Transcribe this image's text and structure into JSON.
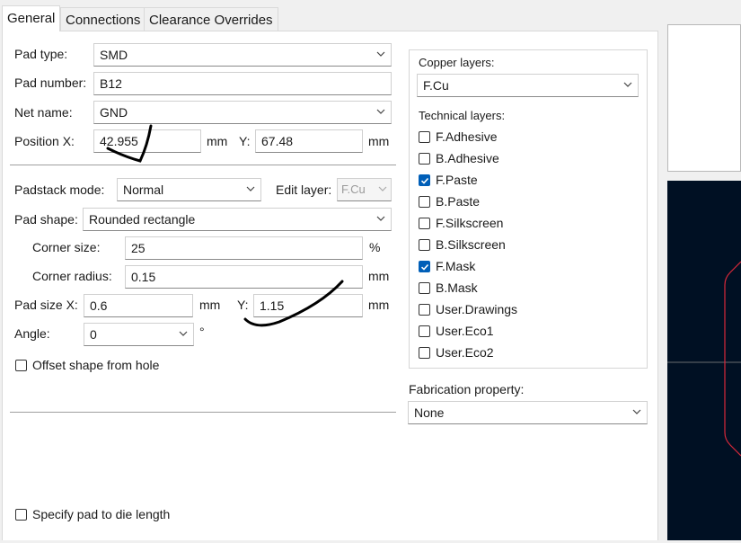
{
  "tabs": [
    "General",
    "Connections",
    "Clearance Overrides"
  ],
  "general": {
    "pad_type_label": "Pad type:",
    "pad_type_value": "SMD",
    "pad_number_label": "Pad number:",
    "pad_number_value": "B12",
    "net_name_label": "Net name:",
    "net_name_value": "GND",
    "position_x_label": "Position X:",
    "position_x_value": "42.955",
    "position_x_unit": "mm",
    "position_y_label": "Y:",
    "position_y_value": "67.48",
    "position_y_unit": "mm",
    "padstack_mode_label": "Padstack mode:",
    "padstack_mode_value": "Normal",
    "edit_layer_label": "Edit layer:",
    "edit_layer_value": "F.Cu",
    "pad_shape_label": "Pad shape:",
    "pad_shape_value": "Rounded rectangle",
    "corner_size_label": "Corner size:",
    "corner_size_value": "25",
    "corner_size_unit": "%",
    "corner_radius_label": "Corner radius:",
    "corner_radius_value": "0.15",
    "corner_radius_unit": "mm",
    "pad_size_x_label": "Pad size X:",
    "pad_size_x_value": "0.6",
    "pad_size_x_unit": "mm",
    "pad_size_y_label": "Y:",
    "pad_size_y_value": "1.15",
    "pad_size_y_unit": "mm",
    "angle_label": "Angle:",
    "angle_value": "0",
    "angle_unit": "°",
    "offset_shape_label": "Offset shape from hole",
    "offset_shape_checked": false,
    "die_length_label": "Specify pad to die length",
    "die_length_checked": false
  },
  "layers": {
    "copper_label": "Copper layers:",
    "copper_value": "F.Cu",
    "technical_label": "Technical layers:",
    "items": [
      {
        "name": "F.Adhesive",
        "checked": false
      },
      {
        "name": "B.Adhesive",
        "checked": false
      },
      {
        "name": "F.Paste",
        "checked": true
      },
      {
        "name": "B.Paste",
        "checked": false
      },
      {
        "name": "F.Silkscreen",
        "checked": false
      },
      {
        "name": "B.Silkscreen",
        "checked": false
      },
      {
        "name": "F.Mask",
        "checked": true
      },
      {
        "name": "B.Mask",
        "checked": false
      },
      {
        "name": "User.Drawings",
        "checked": false
      },
      {
        "name": "User.Eco1",
        "checked": false
      },
      {
        "name": "User.Eco2",
        "checked": false
      }
    ]
  },
  "fabrication": {
    "label": "Fabrication property:",
    "value": "None"
  },
  "colors": {
    "accent": "#005fb8",
    "preview_background": "#001023",
    "pad_outline": "#d8283a",
    "annotation_ink": "#000000"
  }
}
